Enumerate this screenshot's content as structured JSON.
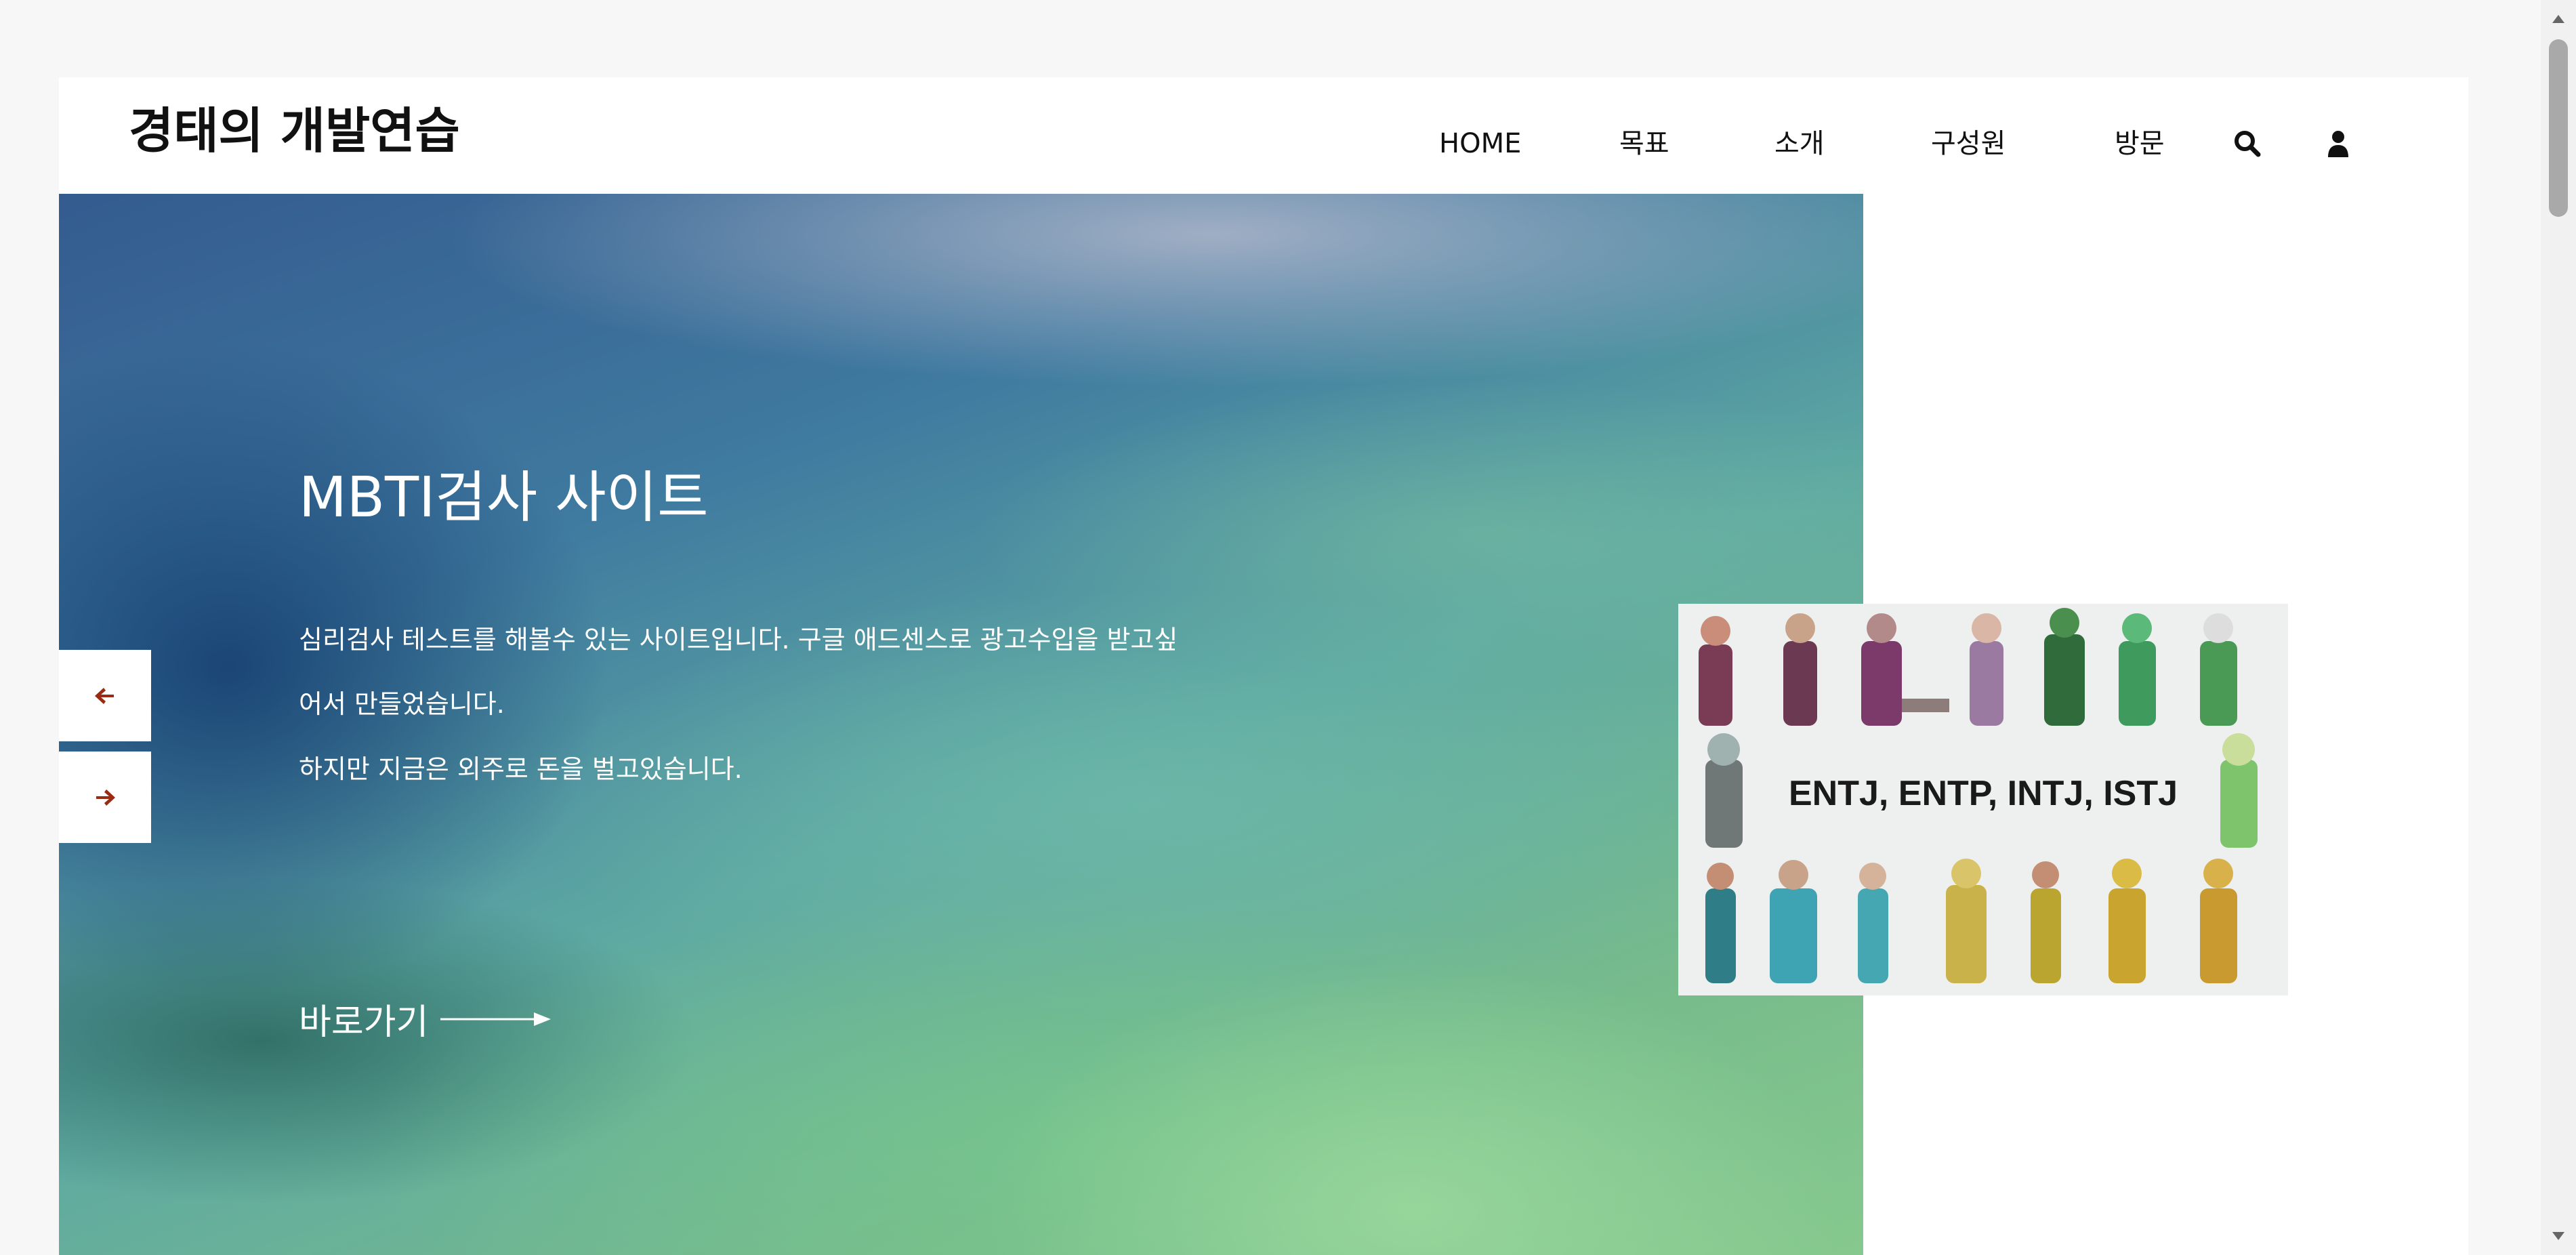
{
  "header": {
    "brand": "경태의 개발연습",
    "nav": [
      {
        "label": "HOME"
      },
      {
        "label": "목표"
      },
      {
        "label": "소개"
      },
      {
        "label": "구성원"
      },
      {
        "label": "방문"
      }
    ],
    "icons": [
      "search-icon",
      "user-icon"
    ]
  },
  "hero": {
    "title": "MBTI검사 사이트",
    "desc_line1": "심리검사 테스트를 해볼수 있는 사이트입니다. 구글 애드센스로 광고수입을 받고싶",
    "desc_line2": "어서 만들었습니다.",
    "desc_line3": "하지만 지금은 외주로 돈을 벌고있습니다.",
    "cta": "바로가기",
    "prev_icon": "arrow-left-icon",
    "next_icon": "arrow-right-icon",
    "thumbnail_text": "ENTJ, ENTP, INTJ, ISTJ"
  },
  "colors": {
    "arrow_accent": "#9a2a12",
    "text_dark": "#111111",
    "hero_text": "#ffffff"
  }
}
